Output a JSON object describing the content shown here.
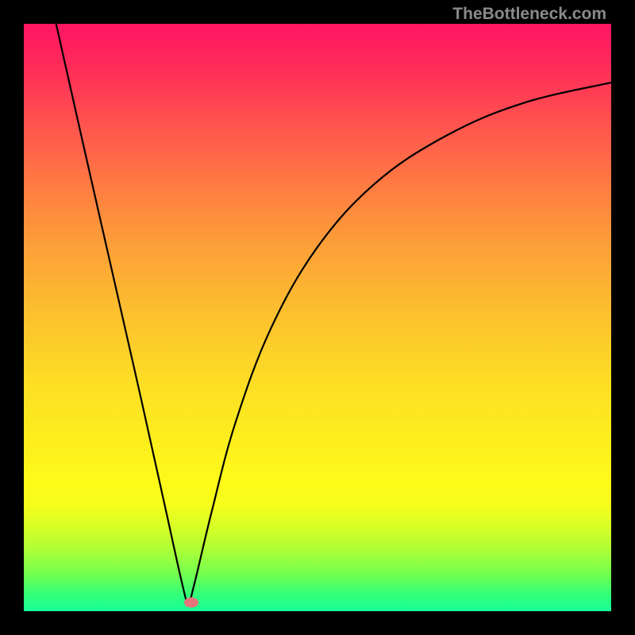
{
  "watermark": "TheBottleneck.com",
  "chart_data": {
    "type": "line",
    "title": "",
    "xlabel": "",
    "ylabel": "",
    "xlim": [
      0,
      100
    ],
    "ylim": [
      0,
      100
    ],
    "grid": false,
    "note": "V-shaped bottleneck curve over red-to-green gradient. Minimum near x≈28. Left branch nearly linear from top-left; right branch concave rising toward top-right. Values are estimated from pixel positions (no axis ticks present).",
    "series": [
      {
        "name": "bottleneck-curve",
        "points": [
          {
            "x": 5.5,
            "y": 100
          },
          {
            "x": 10,
            "y": 80
          },
          {
            "x": 15,
            "y": 58
          },
          {
            "x": 20,
            "y": 36
          },
          {
            "x": 24,
            "y": 18
          },
          {
            "x": 27,
            "y": 4.5
          },
          {
            "x": 28,
            "y": 1.5
          },
          {
            "x": 29,
            "y": 4.5
          },
          {
            "x": 32,
            "y": 17
          },
          {
            "x": 36,
            "y": 32
          },
          {
            "x": 42,
            "y": 48
          },
          {
            "x": 50,
            "y": 62
          },
          {
            "x": 60,
            "y": 73
          },
          {
            "x": 72,
            "y": 81
          },
          {
            "x": 85,
            "y": 86.5
          },
          {
            "x": 100,
            "y": 90
          }
        ]
      }
    ],
    "marker": {
      "x": 28.5,
      "y": 1.5,
      "color": "#e4737b"
    },
    "gradient_stops": [
      {
        "pos": 0,
        "color": "#ff1563"
      },
      {
        "pos": 50,
        "color": "#fcc22e"
      },
      {
        "pos": 78,
        "color": "#fefa1a"
      },
      {
        "pos": 100,
        "color": "#18ff97"
      }
    ]
  }
}
